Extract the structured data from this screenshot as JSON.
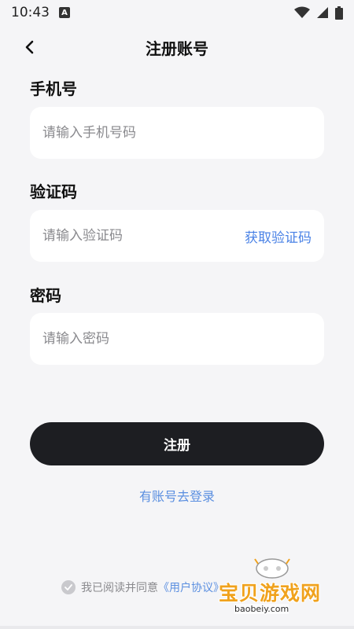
{
  "status": {
    "time": "10:43",
    "notification_glyph": "A"
  },
  "header": {
    "title": "注册账号"
  },
  "form": {
    "phone": {
      "label": "手机号",
      "placeholder": "请输入手机号码",
      "value": ""
    },
    "code": {
      "label": "验证码",
      "placeholder": "请输入验证码",
      "value": "",
      "get_code_label": "获取验证码"
    },
    "password": {
      "label": "密码",
      "placeholder": "请输入密码",
      "value": ""
    }
  },
  "actions": {
    "register_label": "注册",
    "login_link": "有账号去登录"
  },
  "agreement": {
    "prefix": "我已阅读并同意",
    "user_agreement": "《用户协议》"
  },
  "watermark": {
    "text": "宝贝游戏网",
    "url": "baobeiy.com"
  },
  "colors": {
    "background": "#f5f5f7",
    "primary_button": "#1d1e22",
    "link": "#5b8fe0",
    "watermark": "#f0a21d"
  },
  "icons": {
    "back": "chevron-left-icon",
    "wifi": "wifi-icon",
    "signal": "signal-icon",
    "battery": "battery-icon",
    "check": "check-circle-icon"
  }
}
